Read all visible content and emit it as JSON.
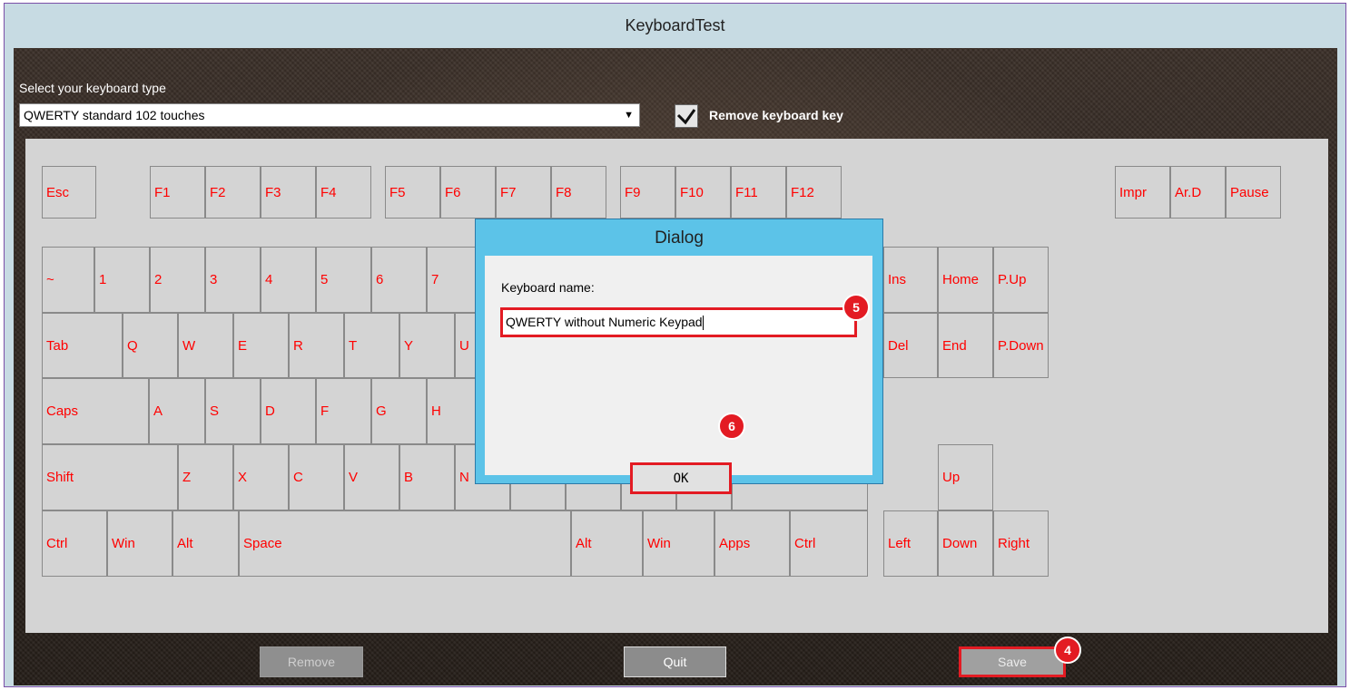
{
  "window": {
    "title": "KeyboardTest"
  },
  "controls": {
    "select_label": "Select your keyboard type",
    "keyboard_type": "QWERTY standard 102 touches",
    "dropdown_arrow": "▼",
    "remove_key_label": "Remove keyboard key",
    "remove_key_checked": true
  },
  "buttons": {
    "remove": "Remove",
    "quit": "Quit",
    "save": "Save"
  },
  "dialog": {
    "title": "Dialog",
    "label": "Keyboard name:",
    "value": "QWERTY without Numeric Keypad",
    "ok": "OK"
  },
  "badges": {
    "save": "4",
    "input": "5",
    "ok": "6"
  },
  "colors": {
    "key_text": "#ff0000",
    "highlight": "#e31b23",
    "dialog_frame": "#5cc3e8"
  },
  "keys": {
    "esc": "Esc",
    "f1": "F1",
    "f2": "F2",
    "f3": "F3",
    "f4": "F4",
    "f5": "F5",
    "f6": "F6",
    "f7": "F7",
    "f8": "F8",
    "f9": "F9",
    "f10": "F10",
    "f11": "F11",
    "f12": "F12",
    "impr": "Impr",
    "ard": "Ar.D",
    "pause": "Pause",
    "tilde": "~",
    "n1": "1",
    "n2": "2",
    "n3": "3",
    "n4": "4",
    "n5": "5",
    "n6": "6",
    "n7": "7",
    "ins": "Ins",
    "home": "Home",
    "pup": "P.Up",
    "tab": "Tab",
    "q": "Q",
    "w": "W",
    "e": "E",
    "r": "R",
    "t": "T",
    "y": "Y",
    "u": "U",
    "del": "Del",
    "end": "End",
    "pdown": "P.Down",
    "caps": "Caps",
    "a": "A",
    "s": "S",
    "d": "D",
    "f": "F",
    "g": "G",
    "h": "H",
    "shift": "Shift",
    "z": "Z",
    "x": "X",
    "c": "C",
    "v": "V",
    "b": "B",
    "n": "N",
    "up": "Up",
    "ctrl_l": "Ctrl",
    "win_l": "Win",
    "alt_l": "Alt",
    "space": "Space",
    "alt_r": "Alt",
    "win_r": "Win",
    "apps": "Apps",
    "ctrl_r": "Ctrl",
    "left": "Left",
    "down": "Down",
    "right": "Right"
  }
}
